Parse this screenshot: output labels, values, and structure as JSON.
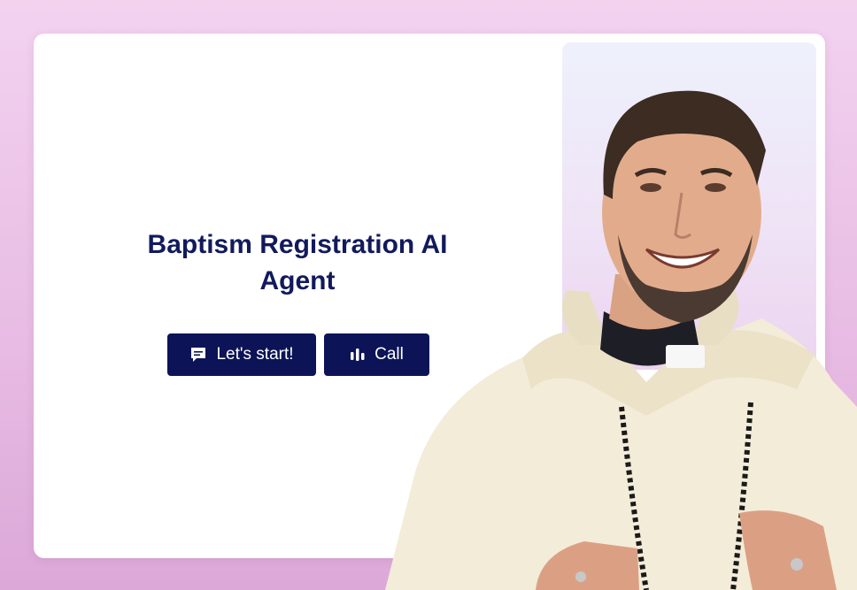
{
  "hero": {
    "title": "Baptism Registration AI Agent"
  },
  "actions": {
    "start_label": "Let's start!",
    "start_icon": "chat-bubble-icon",
    "call_label": "Call",
    "call_icon": "audio-bars-icon"
  },
  "colors": {
    "accent": "#0c1457",
    "title": "#121a5c",
    "background": "#e8bde4",
    "card": "#ffffff"
  },
  "image": {
    "subject": "priest-avatar"
  }
}
